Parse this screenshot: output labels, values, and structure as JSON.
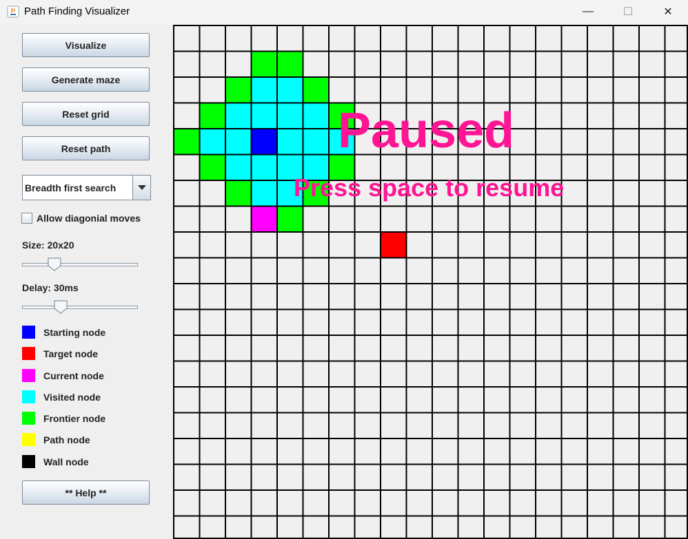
{
  "window": {
    "title": "Path Finding Visualizer",
    "minimize": "—",
    "maximize": "☐",
    "close": "✕"
  },
  "buttons": {
    "visualize": "Visualize",
    "generate_maze": "Generate maze",
    "reset_grid": "Reset grid",
    "reset_path": "Reset path",
    "help": "** Help **"
  },
  "algorithm": {
    "selected": "Breadth first search"
  },
  "diagonal": {
    "label": "Allow diagonial moves",
    "checked": false
  },
  "size": {
    "label": "Size: 20x20",
    "value": 20,
    "fraction": 0.25
  },
  "delay": {
    "label": "Delay: 30ms",
    "value_ms": 30,
    "fraction": 0.31
  },
  "legend": [
    {
      "label": "Starting node",
      "color": "#0000ff"
    },
    {
      "label": "Target node",
      "color": "#ff0000"
    },
    {
      "label": "Current node",
      "color": "#ff00ff"
    },
    {
      "label": "Visited node",
      "color": "#00ffff"
    },
    {
      "label": "Frontier node",
      "color": "#00ff00"
    },
    {
      "label": "Path node",
      "color": "#ffff00"
    },
    {
      "label": "Wall node",
      "color": "#000000"
    }
  ],
  "grid": {
    "rows": 20,
    "cols": 20,
    "colors": {
      "start": "#0000ff",
      "target": "#ff0000",
      "current": "#ff00ff",
      "visited": "#00ffff",
      "frontier": "#00ff00",
      "empty": "#f0f0f0"
    },
    "start": [
      4,
      3
    ],
    "target": [
      8,
      8
    ],
    "current": [
      [
        7,
        3
      ]
    ],
    "visited": [
      [
        2,
        3
      ],
      [
        2,
        4
      ],
      [
        3,
        2
      ],
      [
        3,
        3
      ],
      [
        3,
        4
      ],
      [
        3,
        5
      ],
      [
        4,
        1
      ],
      [
        4,
        2
      ],
      [
        4,
        4
      ],
      [
        4,
        5
      ],
      [
        4,
        6
      ],
      [
        5,
        2
      ],
      [
        5,
        3
      ],
      [
        5,
        4
      ],
      [
        5,
        5
      ],
      [
        6,
        3
      ],
      [
        6,
        4
      ]
    ],
    "frontier": [
      [
        1,
        3
      ],
      [
        1,
        4
      ],
      [
        2,
        2
      ],
      [
        2,
        5
      ],
      [
        3,
        1
      ],
      [
        3,
        6
      ],
      [
        4,
        0
      ],
      [
        5,
        1
      ],
      [
        5,
        6
      ],
      [
        6,
        2
      ],
      [
        6,
        5
      ],
      [
        7,
        4
      ]
    ]
  },
  "overlay": {
    "paused": "Paused",
    "resume_hint": "Press space to resume"
  }
}
